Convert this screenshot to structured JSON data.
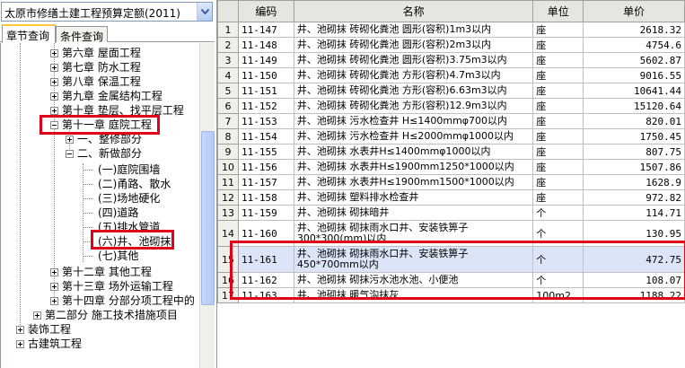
{
  "quota_combo": {
    "value": "太原市修缮土建工程预算定额(2011)"
  },
  "tabs": [
    {
      "label": "章节查询"
    },
    {
      "label": "条件查询"
    }
  ],
  "tree": {
    "ch6": "第六章 屋面工程",
    "ch7": "第七章 防水工程",
    "ch8": "第八章 保温工程",
    "ch9": "第九章 金属结构工程",
    "ch10": "第十章 垫层、找平层工程",
    "ch11": "第十一章 庭院工程",
    "s1": "一、整修部分",
    "s2": "二、新做部分",
    "i1": "(一)庭院围墙",
    "i2": "(二)甬路、散水",
    "i3": "(三)场地硬化",
    "i4": "(四)道路",
    "i5": "(五)排水管道",
    "i6": "(六)井、池砌抹",
    "i7": "(七)其他",
    "ch12": "第十二章 其他工程",
    "ch13": "第十三章 场外运输工程",
    "ch14": "第十四章 分部分项工程中的",
    "part2": "第二部分 施工技术措施项目",
    "decor": "装饰工程",
    "ancient": "古建筑工程"
  },
  "grid": {
    "headers": {
      "code": "编码",
      "name": "名称",
      "unit": "单位",
      "price": "单价"
    },
    "rows": [
      {
        "n": "1",
        "code": "11-147",
        "name": "井、池砌抹 砖砌化粪池 圆形(容积)1m3以内",
        "unit": "座",
        "price": "2618.32"
      },
      {
        "n": "2",
        "code": "11-148",
        "name": "井、池砌抹 砖砌化粪池 圆形(容积)2m3以内",
        "unit": "座",
        "price": "4754.6"
      },
      {
        "n": "3",
        "code": "11-149",
        "name": "井、池砌抹 砖砌化粪池 圆形(容积)3.75m3以内",
        "unit": "座",
        "price": "5602.87"
      },
      {
        "n": "4",
        "code": "11-150",
        "name": "井、池砌抹 砖砌化粪池 方形(容积)4.7m3以内",
        "unit": "座",
        "price": "9016.55"
      },
      {
        "n": "5",
        "code": "11-151",
        "name": "井、池砌抹 砖砌化粪池 方形(容积)6.63m3以内",
        "unit": "座",
        "price": "10641.44"
      },
      {
        "n": "6",
        "code": "11-152",
        "name": "井、池砌抹 砖砌化粪池 方形(容积)12.9m3以内",
        "unit": "座",
        "price": "15120.64"
      },
      {
        "n": "7",
        "code": "11-153",
        "name": "井、池砌抹 污水检查井 H≤1400mmφ700以内",
        "unit": "座",
        "price": "820.01"
      },
      {
        "n": "8",
        "code": "11-154",
        "name": "井、池砌抹 污水检查井 H≤2000mmφ1000以内",
        "unit": "座",
        "price": "1750.45"
      },
      {
        "n": "9",
        "code": "11-155",
        "name": "井、池砌抹 水表井H≤1400mmφ1000以内",
        "unit": "座",
        "price": "807.75"
      },
      {
        "n": "10",
        "code": "11-156",
        "name": "井、池砌抹 水表井H≤1900mm1250*1000以内",
        "unit": "座",
        "price": "1507.86"
      },
      {
        "n": "11",
        "code": "11-157",
        "name": "井、池砌抹 水表井H≤1900mm1500*1000以内",
        "unit": "座",
        "price": "1628.9"
      },
      {
        "n": "12",
        "code": "11-158",
        "name": "井、池砌抹 塑料排水检查井",
        "unit": "座",
        "price": "972.82"
      },
      {
        "n": "13",
        "code": "11-159",
        "name": "井、池砌抹 砌抹暗井",
        "unit": "个",
        "price": "114.71"
      },
      {
        "n": "14",
        "code": "11-160",
        "name": "井、池砌抹 砌抹雨水口井、安装铁箅子 300*300(mm)以内",
        "unit": "个",
        "price": "130.95"
      },
      {
        "n": "15",
        "code": "11-161",
        "name": "井、池砌抹 砌抹雨水口井、安装铁箅子 450*700mm以内",
        "unit": "个",
        "price": "472.75"
      },
      {
        "n": "16",
        "code": "11-162",
        "name": "井、池砌抹 砌抹污水池水池、小便池",
        "unit": "个",
        "price": "108.07"
      },
      {
        "n": "17",
        "code": "11-163",
        "name": "井、池砌抹 暖气沟抹灰",
        "unit": "100m2",
        "price": "1188.22"
      }
    ]
  }
}
